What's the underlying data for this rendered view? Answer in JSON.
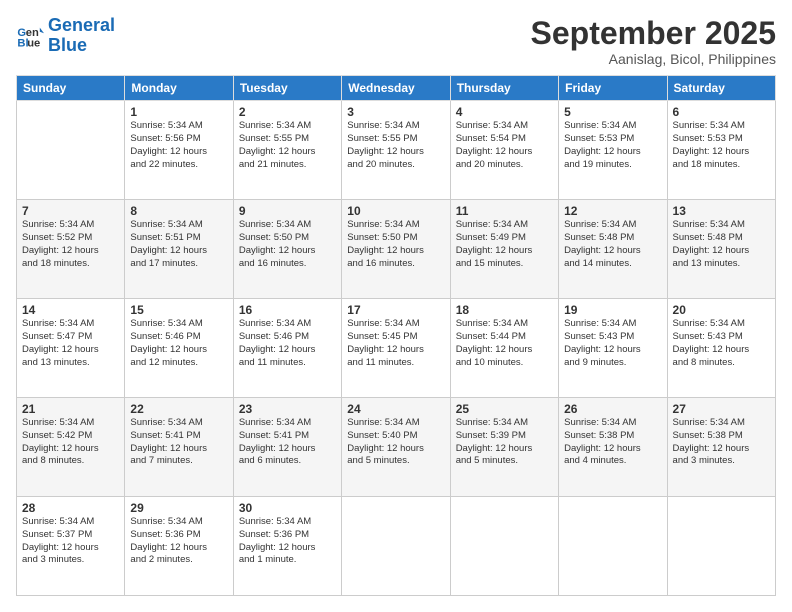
{
  "logo": {
    "line1": "General",
    "line2": "Blue"
  },
  "header": {
    "month": "September 2025",
    "location": "Aanislag, Bicol, Philippines"
  },
  "days": [
    "Sunday",
    "Monday",
    "Tuesday",
    "Wednesday",
    "Thursday",
    "Friday",
    "Saturday"
  ],
  "weeks": [
    [
      null,
      {
        "num": "1",
        "sunrise": "5:34 AM",
        "sunset": "5:56 PM",
        "daylight": "12 hours and 22 minutes."
      },
      {
        "num": "2",
        "sunrise": "5:34 AM",
        "sunset": "5:55 PM",
        "daylight": "12 hours and 21 minutes."
      },
      {
        "num": "3",
        "sunrise": "5:34 AM",
        "sunset": "5:55 PM",
        "daylight": "12 hours and 20 minutes."
      },
      {
        "num": "4",
        "sunrise": "5:34 AM",
        "sunset": "5:54 PM",
        "daylight": "12 hours and 20 minutes."
      },
      {
        "num": "5",
        "sunrise": "5:34 AM",
        "sunset": "5:53 PM",
        "daylight": "12 hours and 19 minutes."
      },
      {
        "num": "6",
        "sunrise": "5:34 AM",
        "sunset": "5:53 PM",
        "daylight": "12 hours and 18 minutes."
      }
    ],
    [
      {
        "num": "7",
        "sunrise": "5:34 AM",
        "sunset": "5:52 PM",
        "daylight": "12 hours and 18 minutes."
      },
      {
        "num": "8",
        "sunrise": "5:34 AM",
        "sunset": "5:51 PM",
        "daylight": "12 hours and 17 minutes."
      },
      {
        "num": "9",
        "sunrise": "5:34 AM",
        "sunset": "5:50 PM",
        "daylight": "12 hours and 16 minutes."
      },
      {
        "num": "10",
        "sunrise": "5:34 AM",
        "sunset": "5:50 PM",
        "daylight": "12 hours and 16 minutes."
      },
      {
        "num": "11",
        "sunrise": "5:34 AM",
        "sunset": "5:49 PM",
        "daylight": "12 hours and 15 minutes."
      },
      {
        "num": "12",
        "sunrise": "5:34 AM",
        "sunset": "5:48 PM",
        "daylight": "12 hours and 14 minutes."
      },
      {
        "num": "13",
        "sunrise": "5:34 AM",
        "sunset": "5:48 PM",
        "daylight": "12 hours and 13 minutes."
      }
    ],
    [
      {
        "num": "14",
        "sunrise": "5:34 AM",
        "sunset": "5:47 PM",
        "daylight": "12 hours and 13 minutes."
      },
      {
        "num": "15",
        "sunrise": "5:34 AM",
        "sunset": "5:46 PM",
        "daylight": "12 hours and 12 minutes."
      },
      {
        "num": "16",
        "sunrise": "5:34 AM",
        "sunset": "5:46 PM",
        "daylight": "12 hours and 11 minutes."
      },
      {
        "num": "17",
        "sunrise": "5:34 AM",
        "sunset": "5:45 PM",
        "daylight": "12 hours and 11 minutes."
      },
      {
        "num": "18",
        "sunrise": "5:34 AM",
        "sunset": "5:44 PM",
        "daylight": "12 hours and 10 minutes."
      },
      {
        "num": "19",
        "sunrise": "5:34 AM",
        "sunset": "5:43 PM",
        "daylight": "12 hours and 9 minutes."
      },
      {
        "num": "20",
        "sunrise": "5:34 AM",
        "sunset": "5:43 PM",
        "daylight": "12 hours and 8 minutes."
      }
    ],
    [
      {
        "num": "21",
        "sunrise": "5:34 AM",
        "sunset": "5:42 PM",
        "daylight": "12 hours and 8 minutes."
      },
      {
        "num": "22",
        "sunrise": "5:34 AM",
        "sunset": "5:41 PM",
        "daylight": "12 hours and 7 minutes."
      },
      {
        "num": "23",
        "sunrise": "5:34 AM",
        "sunset": "5:41 PM",
        "daylight": "12 hours and 6 minutes."
      },
      {
        "num": "24",
        "sunrise": "5:34 AM",
        "sunset": "5:40 PM",
        "daylight": "12 hours and 5 minutes."
      },
      {
        "num": "25",
        "sunrise": "5:34 AM",
        "sunset": "5:39 PM",
        "daylight": "12 hours and 5 minutes."
      },
      {
        "num": "26",
        "sunrise": "5:34 AM",
        "sunset": "5:38 PM",
        "daylight": "12 hours and 4 minutes."
      },
      {
        "num": "27",
        "sunrise": "5:34 AM",
        "sunset": "5:38 PM",
        "daylight": "12 hours and 3 minutes."
      }
    ],
    [
      {
        "num": "28",
        "sunrise": "5:34 AM",
        "sunset": "5:37 PM",
        "daylight": "12 hours and 3 minutes."
      },
      {
        "num": "29",
        "sunrise": "5:34 AM",
        "sunset": "5:36 PM",
        "daylight": "12 hours and 2 minutes."
      },
      {
        "num": "30",
        "sunrise": "5:34 AM",
        "sunset": "5:36 PM",
        "daylight": "12 hours and 1 minute."
      },
      null,
      null,
      null,
      null
    ]
  ],
  "labels": {
    "sunrise": "Sunrise:",
    "sunset": "Sunset:",
    "daylight": "Daylight:"
  }
}
